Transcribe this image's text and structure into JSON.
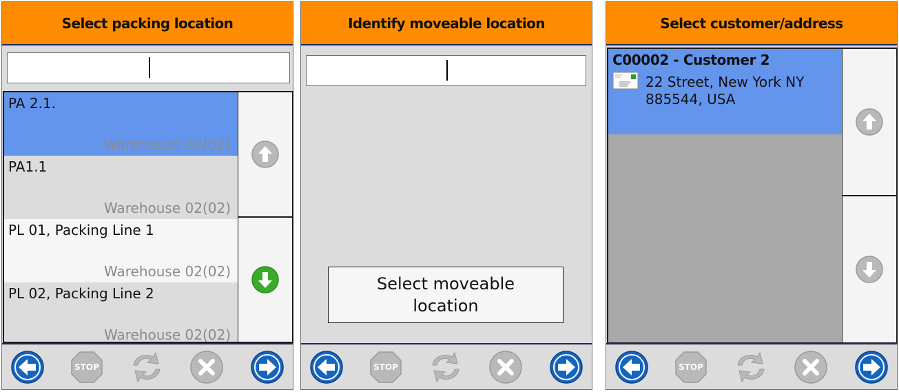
{
  "panels": [
    {
      "title": "Select packing location",
      "input_value": "",
      "items": [
        {
          "title": "PA 2.1.",
          "subtitle": "Warehouse 02(02)"
        },
        {
          "title": "PA1.1",
          "subtitle": "Warehouse 02(02)"
        },
        {
          "title": "PL 01, Packing Line 1",
          "subtitle": "Warehouse 02(02)"
        },
        {
          "title": "PL 02, Packing Line 2",
          "subtitle": "Warehouse 02(02)"
        }
      ]
    },
    {
      "title": "Identify moveable location",
      "input_value": "",
      "button_label": "Select moveable location"
    },
    {
      "title": "Select customer/address",
      "customer": {
        "name": "C00002 - Customer 2",
        "address": "22 Street, New York NY\n885544, USA"
      }
    }
  ],
  "toolbar": {
    "stop_label": "STOP",
    "icons": [
      "back-arrow-icon",
      "stop-icon",
      "refresh-icon",
      "cancel-icon",
      "forward-arrow-icon"
    ]
  },
  "colors": {
    "header": "#ff8c00",
    "selected_row": "#6495ed",
    "toolbar_blue": "#1565c0",
    "scroll_down_active": "#3aaa2a",
    "disabled_gray": "#b9b9b9"
  }
}
